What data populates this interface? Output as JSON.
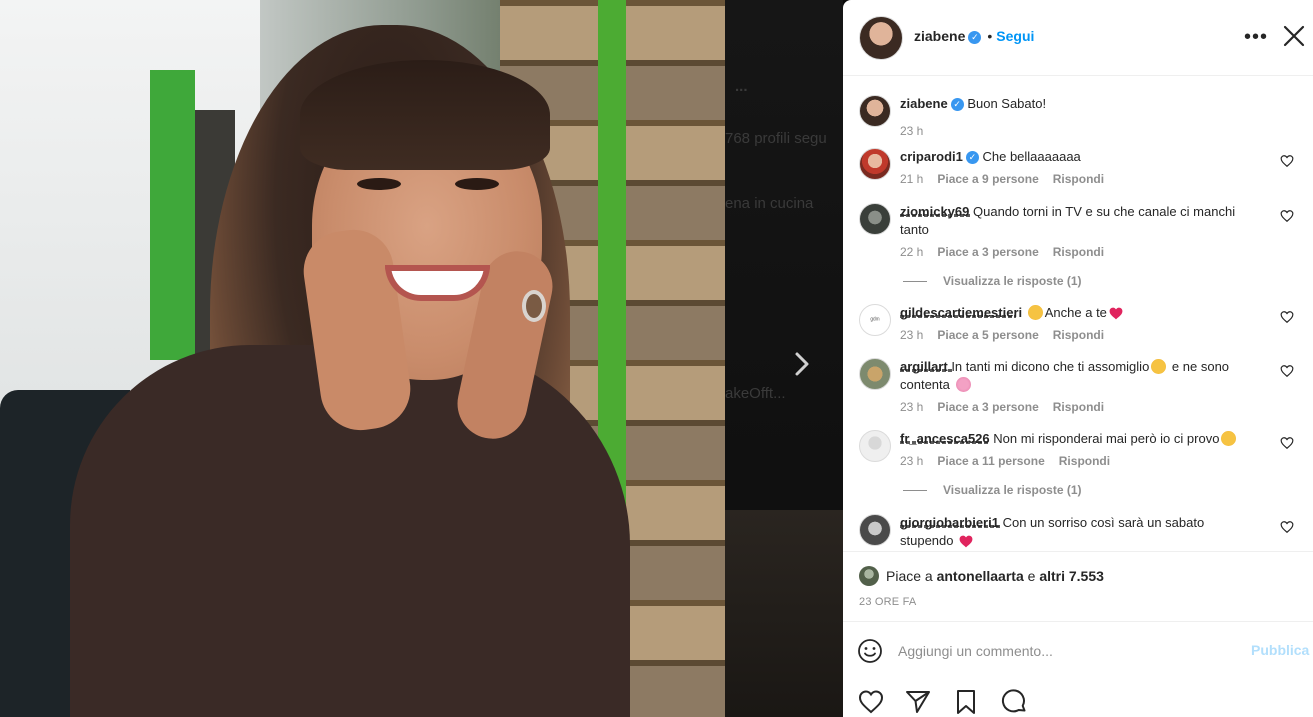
{
  "post": {
    "author": "ziabene",
    "follow_label": "Segui",
    "caption": "Buon Sabato!",
    "caption_time": "23 h"
  },
  "comments": [
    {
      "user": "criparodi1",
      "verified": true,
      "text": "Che bellaaaaaaa",
      "time": "21 h",
      "likes": "Piace a 9 persone",
      "reply": "Rispondi"
    },
    {
      "user": "ziomicky69",
      "verified": false,
      "text": "Quando torni in TV e su che canale ci manchi tanto",
      "time": "22 h",
      "likes": "Piace a 3 persone",
      "reply": "Rispondi",
      "view_replies": "Visualizza le risposte (1)"
    },
    {
      "user": "gildescartiemestieri",
      "verified": false,
      "text": "Anche a te",
      "time": "23 h",
      "likes": "Piace a 5 persone",
      "reply": "Rispondi"
    },
    {
      "user": "argillart",
      "verified": false,
      "text": "In tanti mi dicono che ti assomiglio",
      "text2": "e ne sono contenta",
      "time": "23 h",
      "likes": "Piace a 3 persone",
      "reply": "Rispondi"
    },
    {
      "user": "fr_ancesca526",
      "verified": false,
      "text": "Non mi risponderai mai però io ci provo",
      "time": "23 h",
      "likes": "Piace a 11 persone",
      "reply": "Rispondi",
      "view_replies": "Visualizza le risposte (1)"
    },
    {
      "user": "giorgiobarbieri1",
      "verified": false,
      "text": "Con un sorriso così sarà un sabato stupendo"
    }
  ],
  "likes": {
    "prefix": "Piace a",
    "user": "antonellaarta",
    "joiner": "e",
    "others": "altri 7.553"
  },
  "time_ago": "23 ORE FA",
  "comment_bar": {
    "placeholder": "Aggiungi un commento...",
    "publish_label": "Pubblica"
  },
  "icons": {
    "more": "more-options-icon",
    "close": "close-icon",
    "next": "chevron-right-icon",
    "emoji": "emoji-smile-icon",
    "like": "heart-icon",
    "share": "paper-plane-icon",
    "save": "bookmark-icon",
    "comment": "speech-bubble-icon"
  },
  "colors": {
    "accent": "#0095f6",
    "verified": "#3897f0",
    "muted": "#8e8e8e",
    "publish_disabled": "#b2dffc"
  },
  "background_ghost": {
    "dots": "...",
    "follows": "768 profili segu",
    "bio": "ena in cucina",
    "link": "akeOfft..."
  }
}
